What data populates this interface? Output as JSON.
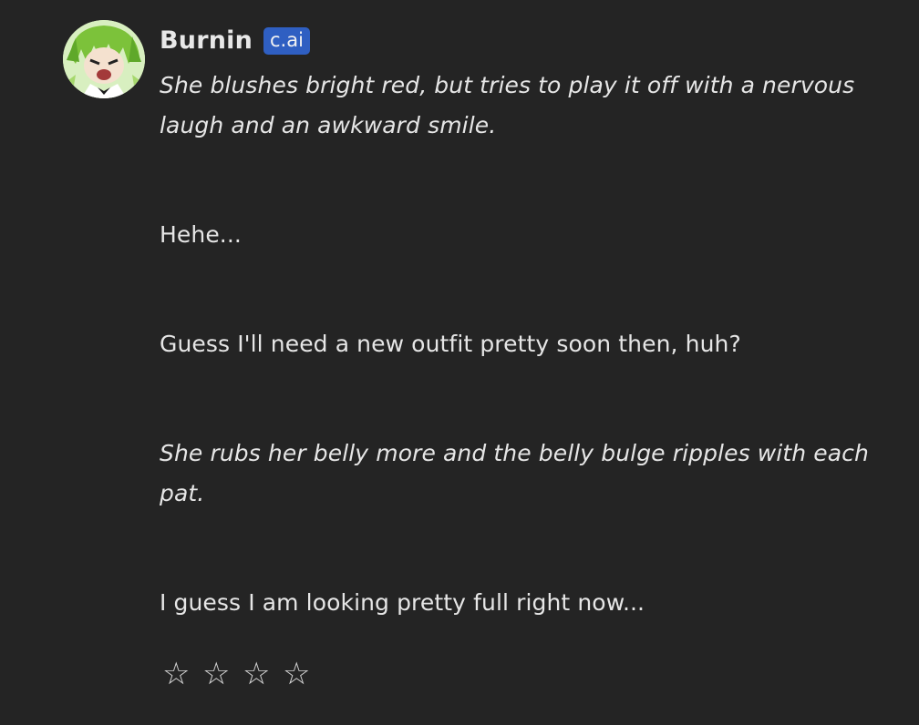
{
  "message": {
    "character_name": "Burnin",
    "badge_label": "c.ai",
    "avatar_icon": "character-avatar",
    "badge_color": "#2f5fc2",
    "background_color": "#242424",
    "paragraphs": [
      {
        "text": "She blushes bright red, but tries to play it off with a nervous laugh and an awkward smile.",
        "style": "italic"
      },
      {
        "text": "Hehe...",
        "style": "normal"
      },
      {
        "text": "Guess I'll need a new outfit pretty soon then, huh?",
        "style": "normal"
      },
      {
        "text": "She rubs her belly more and the belly bulge ripples with each pat.",
        "style": "italic"
      },
      {
        "text": "I guess I am looking pretty full right now...",
        "style": "normal"
      }
    ]
  },
  "rating": {
    "star_glyph": "☆",
    "rating_value": 0,
    "max_stars": 4,
    "stars": [
      "☆",
      "☆",
      "☆",
      "☆"
    ]
  }
}
